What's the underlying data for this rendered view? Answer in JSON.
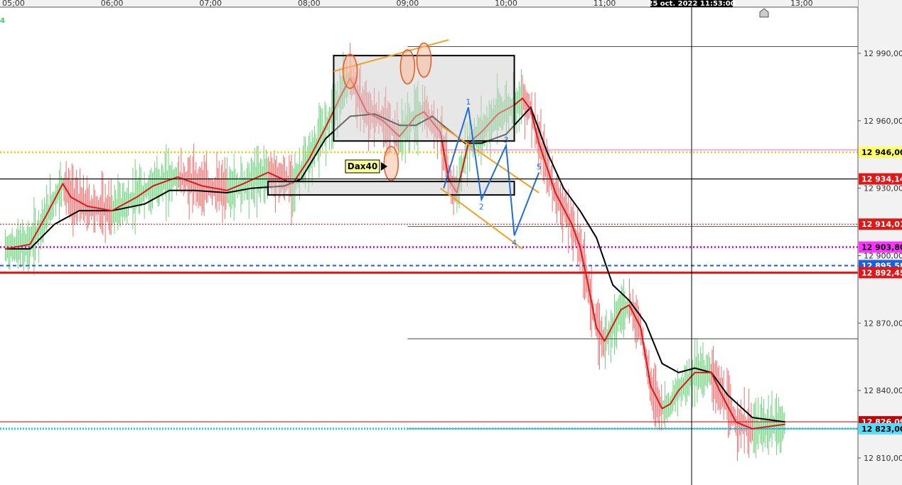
{
  "chart_data": {
    "type": "line",
    "instrument_label": "Dax40",
    "corner_label": "4",
    "crosshair_time": "25 oct. 2022 11:53:00",
    "x_ticks": [
      "05:00",
      "06:00",
      "07:00",
      "08:00",
      "09:00",
      "10:00",
      "11:00",
      "13:00"
    ],
    "x_range": [
      "05:00",
      "13:00"
    ],
    "y_ticks": [
      12990,
      12960,
      12930,
      12900,
      12870,
      12840,
      12810
    ],
    "y_tick_labels": [
      "12 990,00",
      "12 960,00",
      "12 930,00",
      "12 900,00",
      "12 870,00",
      "12 840,00",
      "12 810,00"
    ],
    "ylim": [
      12800,
      13004
    ],
    "grid": false,
    "price_levels": [
      {
        "value": 12946.0,
        "label": "12 946,00",
        "color": "#e8d000",
        "style": "dotted",
        "badge_bg": "#ffff66",
        "badge_fg": "#000000"
      },
      {
        "value": 12934.14,
        "label": "12 934,14",
        "color": "#000000",
        "style": "solid",
        "badge_bg": "#e01818",
        "badge_fg": "#ffffff"
      },
      {
        "value": 12914.01,
        "label": "12 914,01",
        "color": "#c00000",
        "style": "dotted-thin",
        "badge_bg": "#e01818",
        "badge_fg": "#ffffff"
      },
      {
        "value": 12903.8,
        "label": "12 903,80",
        "color": "#cc00cc",
        "style": "dotted",
        "badge_bg": "#ff33ff",
        "badge_fg": "#000000"
      },
      {
        "value": 12895.58,
        "label": "12 895,58",
        "color": "#1e5fd0",
        "style": "dashed",
        "badge_bg": "#1e5fe0",
        "badge_fg": "#ffffff"
      },
      {
        "value": 12892.45,
        "label": "12 892,45",
        "color": "#e01818",
        "style": "solid-thick",
        "badge_bg": "#e01818",
        "badge_fg": "#ffffff"
      },
      {
        "value": 12826.09,
        "label": "12 826,09",
        "color": "#c00000",
        "style": "solid-thin",
        "badge_bg": "#c80000",
        "badge_fg": "#ffffff"
      },
      {
        "value": 12823.0,
        "label": "12 823,00",
        "color": "#22ccee",
        "style": "dotted-thick",
        "badge_bg": "#55ddff",
        "badge_fg": "#000000"
      }
    ],
    "ema_fast": {
      "color": "#e01818",
      "points": [
        [
          "04:55",
          12903
        ],
        [
          "05:10",
          12905
        ],
        [
          "05:20",
          12918
        ],
        [
          "05:30",
          12932
        ],
        [
          "05:35",
          12926
        ],
        [
          "05:45",
          12922
        ],
        [
          "06:00",
          12920
        ],
        [
          "06:15",
          12926
        ],
        [
          "06:25",
          12931
        ],
        [
          "06:40",
          12935
        ],
        [
          "06:55",
          12931
        ],
        [
          "07:10",
          12929
        ],
        [
          "07:20",
          12932
        ],
        [
          "07:35",
          12937
        ],
        [
          "07:50",
          12932
        ],
        [
          "08:00",
          12943
        ],
        [
          "08:10",
          12957
        ],
        [
          "08:20",
          12972
        ],
        [
          "08:25",
          12979
        ],
        [
          "08:35",
          12964
        ],
        [
          "08:45",
          12960
        ],
        [
          "08:55",
          12953
        ],
        [
          "09:05",
          12962
        ],
        [
          "09:10",
          12964
        ],
        [
          "09:20",
          12955
        ],
        [
          "09:25",
          12934
        ],
        [
          "09:30",
          12928
        ],
        [
          "09:37",
          12950
        ],
        [
          "09:45",
          12955
        ],
        [
          "09:55",
          12963
        ],
        [
          "10:05",
          12967
        ],
        [
          "10:10",
          12970
        ],
        [
          "10:15",
          12965
        ],
        [
          "10:20",
          12950
        ],
        [
          "10:30",
          12928
        ],
        [
          "10:40",
          12914
        ],
        [
          "10:45",
          12904
        ],
        [
          "10:50",
          12887
        ],
        [
          "10:55",
          12868
        ],
        [
          "11:00",
          12862
        ],
        [
          "11:10",
          12876
        ],
        [
          "11:15",
          12878
        ],
        [
          "11:22",
          12868
        ],
        [
          "11:28",
          12842
        ],
        [
          "11:35",
          12832
        ],
        [
          "11:40",
          12834
        ],
        [
          "11:45",
          12840
        ],
        [
          "11:55",
          12848
        ],
        [
          "12:05",
          12848
        ],
        [
          "12:10",
          12840
        ],
        [
          "12:20",
          12826
        ],
        [
          "12:30",
          12823
        ],
        [
          "12:40",
          12824
        ],
        [
          "12:50",
          12825
        ]
      ]
    },
    "ema_slow": {
      "color": "#000000",
      "points": [
        [
          "04:55",
          12903
        ],
        [
          "05:10",
          12903
        ],
        [
          "05:25",
          12914
        ],
        [
          "05:40",
          12920
        ],
        [
          "06:00",
          12920
        ],
        [
          "06:20",
          12923
        ],
        [
          "06:35",
          12929
        ],
        [
          "06:50",
          12929
        ],
        [
          "07:10",
          12928
        ],
        [
          "07:25",
          12930
        ],
        [
          "07:45",
          12931
        ],
        [
          "07:55",
          12934
        ],
        [
          "08:10",
          12952
        ],
        [
          "08:25",
          12962
        ],
        [
          "08:40",
          12963
        ],
        [
          "08:55",
          12958
        ],
        [
          "09:05",
          12958
        ],
        [
          "09:15",
          12962
        ],
        [
          "09:25",
          12956
        ],
        [
          "09:35",
          12950
        ],
        [
          "09:45",
          12950
        ],
        [
          "10:00",
          12954
        ],
        [
          "10:10",
          12962
        ],
        [
          "10:15",
          12966
        ],
        [
          "10:25",
          12946
        ],
        [
          "10:35",
          12930
        ],
        [
          "10:45",
          12920
        ],
        [
          "10:55",
          12908
        ],
        [
          "11:05",
          12887
        ],
        [
          "11:15",
          12880
        ],
        [
          "11:25",
          12870
        ],
        [
          "11:35",
          12852
        ],
        [
          "11:45",
          12848
        ],
        [
          "11:55",
          12850
        ],
        [
          "12:05",
          12848
        ],
        [
          "12:15",
          12838
        ],
        [
          "12:30",
          12828
        ],
        [
          "12:40",
          12827
        ],
        [
          "12:50",
          12826
        ]
      ]
    },
    "annotations": {
      "rectangles": [
        {
          "x0": "08:15",
          "x1": "10:05",
          "y0": 12951,
          "y1": 12989
        },
        {
          "x0": "07:35",
          "x1": "10:05",
          "y0": 12927,
          "y1": 12933
        }
      ],
      "channel_upper": [
        [
          "08:15",
          12982
        ],
        [
          "09:25",
          12996
        ]
      ],
      "channel_lower_a": [
        [
          "09:20",
          12958
        ],
        [
          "10:20",
          12928
        ]
      ],
      "channel_lower_b": [
        [
          "09:20",
          12930
        ],
        [
          "10:10",
          12903
        ]
      ],
      "elliptical_highlights": [
        {
          "t": "08:25",
          "v": 12982
        },
        {
          "t": "09:00",
          "v": 12984
        },
        {
          "t": "09:10",
          "v": 12987
        },
        {
          "t": "08:50",
          "v": 12941
        }
      ],
      "wave": [
        [
          "09:22",
          12930
        ],
        [
          "09:37",
          12966
        ],
        [
          "09:45",
          12925
        ],
        [
          "10:00",
          12949
        ],
        [
          "10:05",
          12909
        ],
        [
          "10:20",
          12937
        ]
      ],
      "wave_labels": [
        {
          "text": "1",
          "t": "09:37",
          "v": 12966
        },
        {
          "text": "2",
          "t": "09:45",
          "v": 12925
        },
        {
          "text": "3",
          "t": "10:00",
          "v": 12949
        },
        {
          "text": "4",
          "t": "10:05",
          "v": 12909
        },
        {
          "text": "5",
          "t": "10:20",
          "v": 12937
        }
      ],
      "horizontal_segments": [
        {
          "x0": "09:00",
          "v": 12993
        },
        {
          "x0": "09:00",
          "v": 12913
        },
        {
          "x0": "09:00",
          "v": 12863
        },
        {
          "x0": "09:00",
          "v": 12823
        }
      ],
      "magenta_line": 12947,
      "crosshair_x": "11:53",
      "crosshair_y": 12934.14
    }
  }
}
